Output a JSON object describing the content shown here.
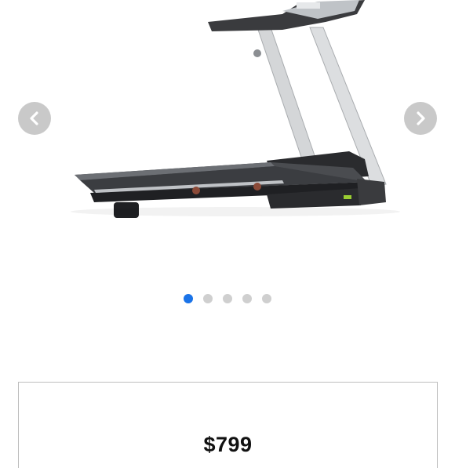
{
  "gallery": {
    "image_subject": "treadmill",
    "prev_icon": "chevron-left-icon",
    "next_icon": "chevron-right-icon",
    "slide_count": 5,
    "active_slide": 1,
    "colors": {
      "active_dot": "#1a73e8",
      "inactive_dot": "#cfcfcf",
      "arrow_bg": "#c9c9c9"
    }
  },
  "product": {
    "price": "$799"
  }
}
